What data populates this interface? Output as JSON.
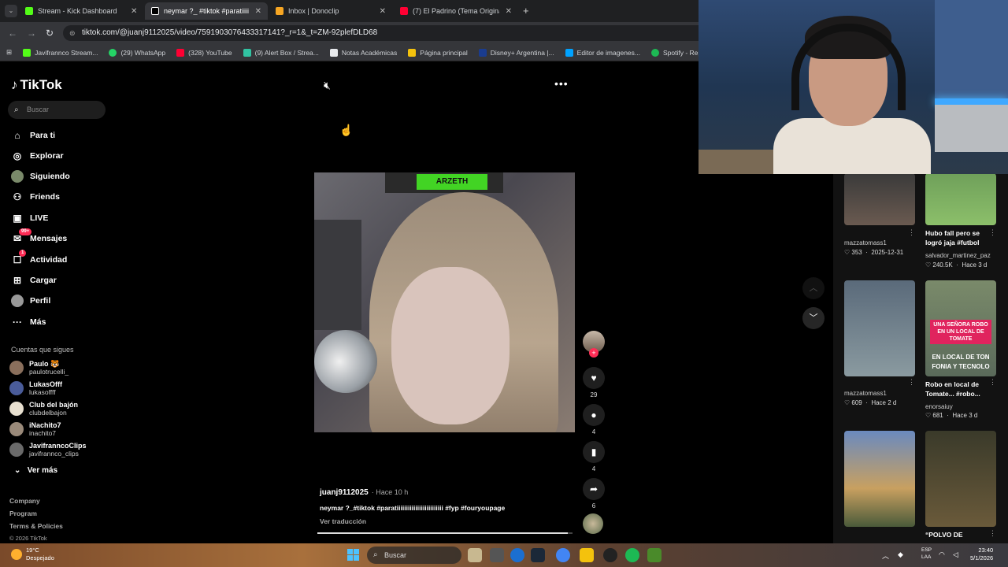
{
  "browser": {
    "tabs": [
      {
        "title": "Stream - Kick Dashboard",
        "color": "#53fc18"
      },
      {
        "title": "neymar ?_ #tiktok #paratiiiiiiiiii",
        "color": "#ffffff"
      },
      {
        "title": "Inbox | Donoclip",
        "color": "#f6a623"
      },
      {
        "title": "(7) El Padrino (Tema Original)/T",
        "color": "#ff0033"
      }
    ],
    "close_glyph": "✕",
    "new_tab_glyph": "+",
    "url": "tiktok.com/@juanj9112025/video/7591903076433317141?_r=1&_t=ZM-92plefDLD68",
    "bookmarks": [
      {
        "label": "Javifrannco Stream...",
        "color": "#53fc18"
      },
      {
        "label": "(29) WhatsApp",
        "color": "#25d366"
      },
      {
        "label": "(328) YouTube",
        "color": "#ff0033"
      },
      {
        "label": "(9) Alert Box / Strea...",
        "color": "#31c3a2"
      },
      {
        "label": "Notas Académicas",
        "color": "#e8eaed"
      },
      {
        "label": "Página principal",
        "color": "#f4c20d"
      },
      {
        "label": "Disney+ Argentina |...",
        "color": "#1a3c8f"
      },
      {
        "label": "Editor de imagenes...",
        "color": "#00a2ff"
      },
      {
        "label": "Spotify - Reproduct...",
        "color": "#1db954"
      }
    ]
  },
  "tiktok": {
    "brand": "TikTok",
    "search_placeholder": "Buscar",
    "nav": [
      {
        "label": "Para ti",
        "icon": "home-icon"
      },
      {
        "label": "Explorar",
        "icon": "compass-icon"
      },
      {
        "label": "Siguiendo",
        "icon": "following-avatar"
      },
      {
        "label": "Friends",
        "icon": "friends-icon"
      },
      {
        "label": "LIVE",
        "icon": "live-icon"
      },
      {
        "label": "Mensajes",
        "icon": "messages-icon",
        "badge": "99+"
      },
      {
        "label": "Actividad",
        "icon": "activity-icon",
        "badge": "1"
      },
      {
        "label": "Cargar",
        "icon": "upload-icon"
      },
      {
        "label": "Perfil",
        "icon": "profile-avatar"
      },
      {
        "label": "Más",
        "icon": "more-icon"
      }
    ],
    "following_title": "Cuentas que sigues",
    "following": [
      {
        "name": "Paulo 🐯",
        "handle": "paulotrucelli_"
      },
      {
        "name": "LukasOfff",
        "handle": "lukasoffff"
      },
      {
        "name": "Club del bajón",
        "handle": "clubdelbajon"
      },
      {
        "name": "iNachito7",
        "handle": "inachito7"
      },
      {
        "name": "JavifranncoClips",
        "handle": "javifrannco_clips"
      }
    ],
    "see_more": "Ver más",
    "footer": [
      "Company",
      "Program",
      "Terms & Policies",
      "© 2026 TikTok"
    ]
  },
  "video": {
    "author": "juanj9112025",
    "time": "· Hace 10 h",
    "caption": "neymar ?_#tiktok #paratiiiiiiiiiiiiiiiiiiiiiiiii #fyp #fouryoupage",
    "translate": "Ver traducción",
    "overlay_text": "ARZETH",
    "likes": "29",
    "comments": "4",
    "saves": "4",
    "shares": "6",
    "progress_fraction": 0.98
  },
  "recommended": [
    {
      "user": "mazzatomass1",
      "likes": "353",
      "date": "2025-12-31"
    },
    {
      "title": "Hubo fall pero se logró jaja #futbol",
      "user": "salvador_martinez_paz",
      "likes": "240.5K",
      "date": "Hace 3 d"
    },
    {
      "user": "mazzatomass1",
      "likes": "609",
      "date": "Hace 2 d"
    },
    {
      "title": "Robo en local de Tomate... #robo...",
      "user": "enorsaiuy",
      "likes": "681",
      "date": "Hace 3 d",
      "thumb_text": "UNA SEÑORA ROBO EN UN LOCAL DE TOMATE",
      "thumb_text2": "EN LOCAL DE TON FONIA Y TECNOLO"
    },
    {},
    {
      "title": "“POLVO DE"
    }
  ],
  "taskbar": {
    "temp": "19°C",
    "weather": "Despejado",
    "search": "Buscar",
    "lang": "ESP\nLAA",
    "time": "23:40",
    "date": "5/1/2026"
  }
}
